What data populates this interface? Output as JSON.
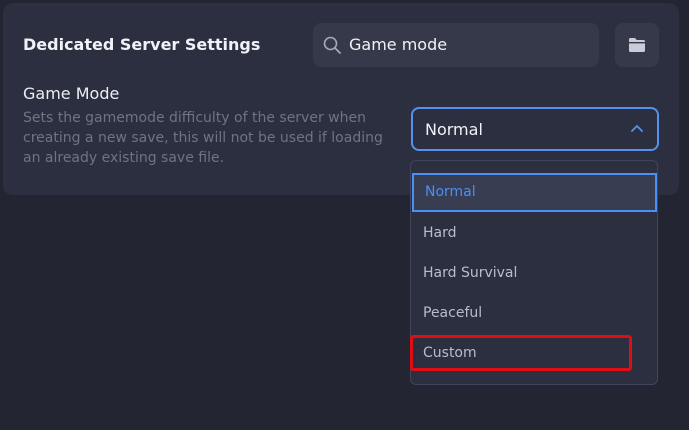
{
  "panel": {
    "title": "Dedicated Server Settings"
  },
  "search": {
    "value": "Game mode",
    "icon": "search-icon"
  },
  "folder_button": {
    "icon": "folder-icon"
  },
  "setting": {
    "label": "Game Mode",
    "description": "Sets the gamemode difficulty of the server when creating a new save, this will not be used if loading an already existing save file."
  },
  "select": {
    "value": "Normal",
    "icon": "chevron-up-icon"
  },
  "dropdown": {
    "options": [
      "Normal",
      "Hard",
      "Hard Survival",
      "Peaceful",
      "Custom"
    ],
    "selected_option": "Normal",
    "highlighted_option": "Custom"
  },
  "colors": {
    "background": "#232532",
    "panel": "#2c2f3f",
    "accent": "#4a8ff5",
    "highlight": "#e00d14"
  }
}
